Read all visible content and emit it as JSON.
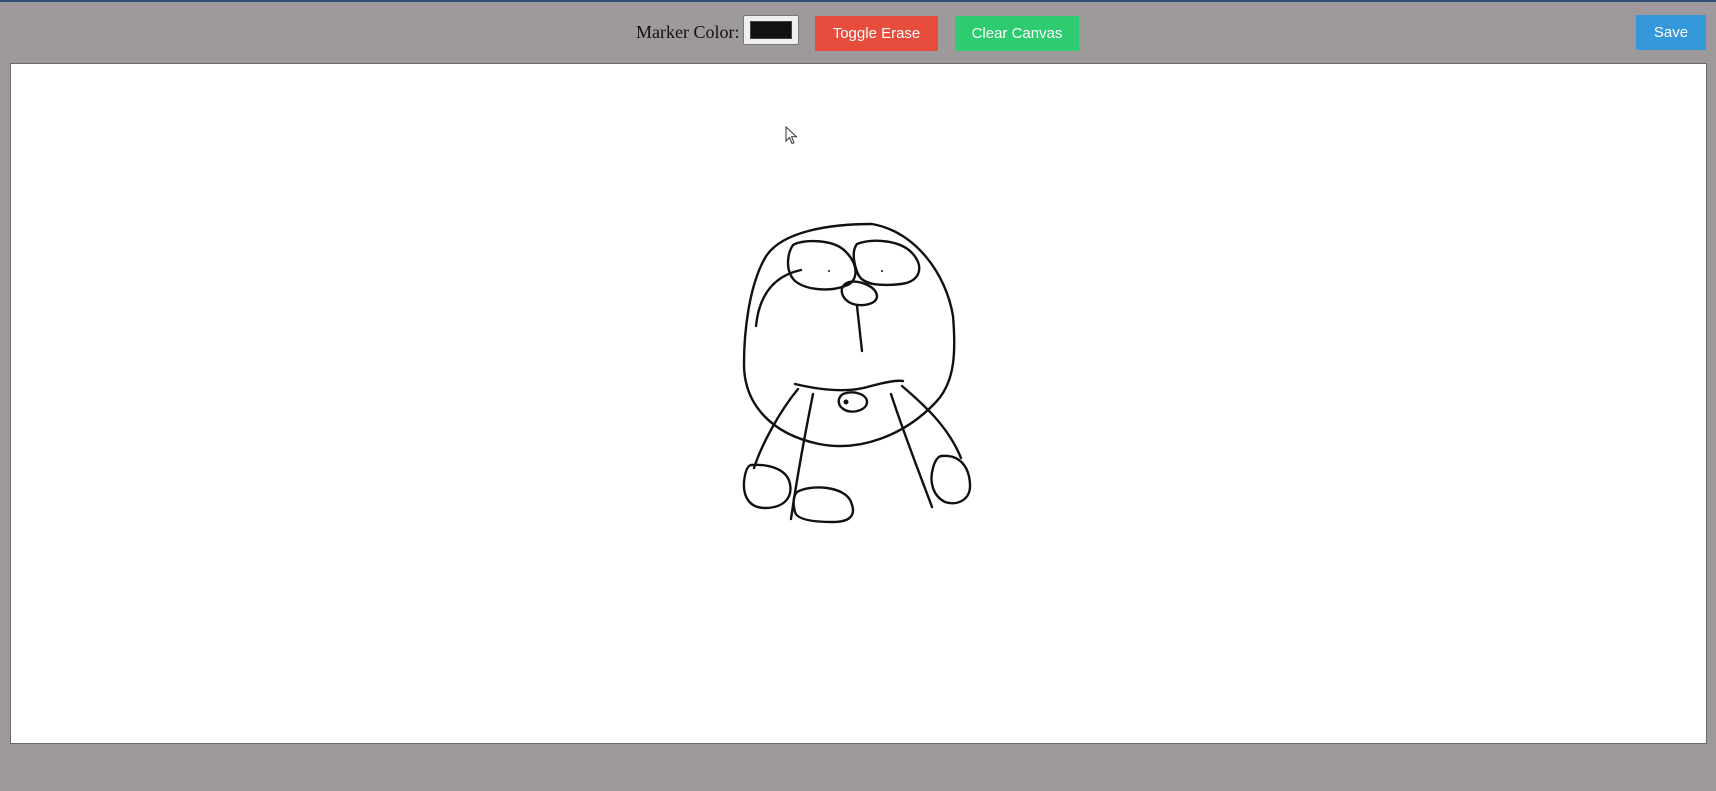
{
  "toolbar": {
    "marker_label": "Marker Color:",
    "marker_color": "#111111",
    "toggle_erase_label": "Toggle Erase",
    "clear_canvas_label": "Clear Canvas",
    "save_label": "Save"
  },
  "colors": {
    "background": "#9e999a",
    "erase_button": "#e74c3c",
    "clear_button": "#2ecc71",
    "save_button": "#3498db",
    "canvas": "#ffffff",
    "stroke": "#111111"
  },
  "canvas": {
    "drawing": "doraemon-sketch"
  },
  "icons": {
    "cursor": "mouse-pointer-icon"
  }
}
